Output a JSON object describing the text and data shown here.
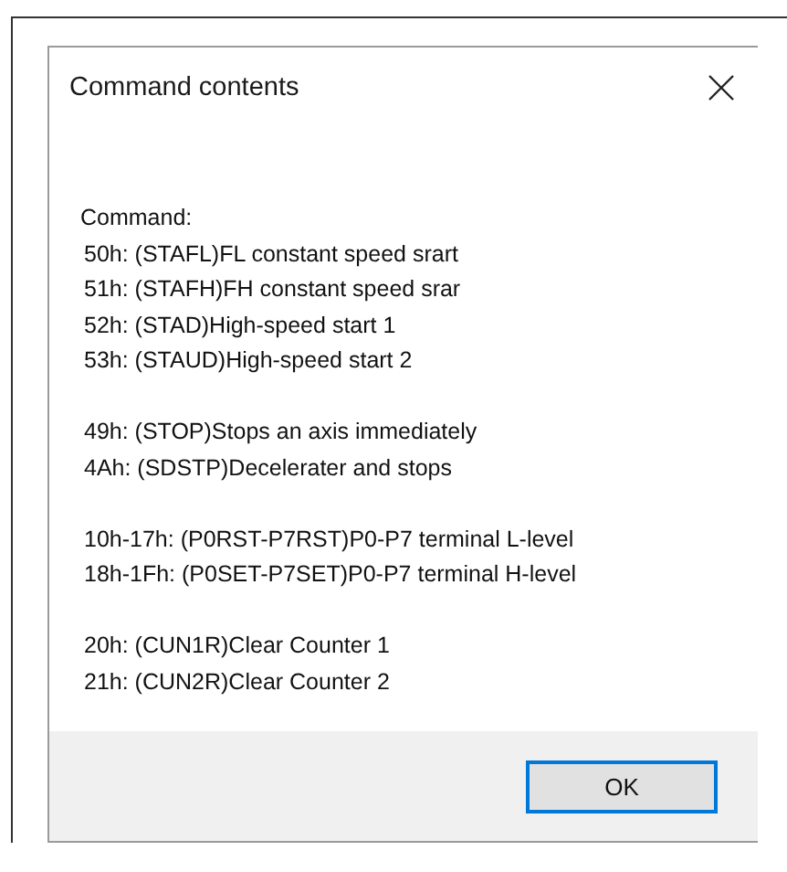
{
  "dialog": {
    "title": "Command contents",
    "heading": "Command:",
    "groups": [
      {
        "lines": [
          "50h: (STAFL)FL constant speed srart",
          "51h: (STAFH)FH constant speed srar",
          "52h: (STAD)High-speed start 1",
          "53h: (STAUD)High-speed start 2"
        ]
      },
      {
        "lines": [
          "49h: (STOP)Stops an axis immediately",
          "4Ah: (SDSTP)Decelerater and stops"
        ]
      },
      {
        "lines": [
          "10h-17h: (P0RST-P7RST)P0-P7 terminal L-level",
          "18h-1Fh: (P0SET-P7SET)P0-P7 terminal H-level"
        ]
      },
      {
        "lines": [
          "20h: (CUN1R)Clear Counter 1",
          "21h: (CUN2R)Clear Counter 2"
        ]
      }
    ],
    "buttons": [
      {
        "label": "OK",
        "default": true
      }
    ]
  }
}
